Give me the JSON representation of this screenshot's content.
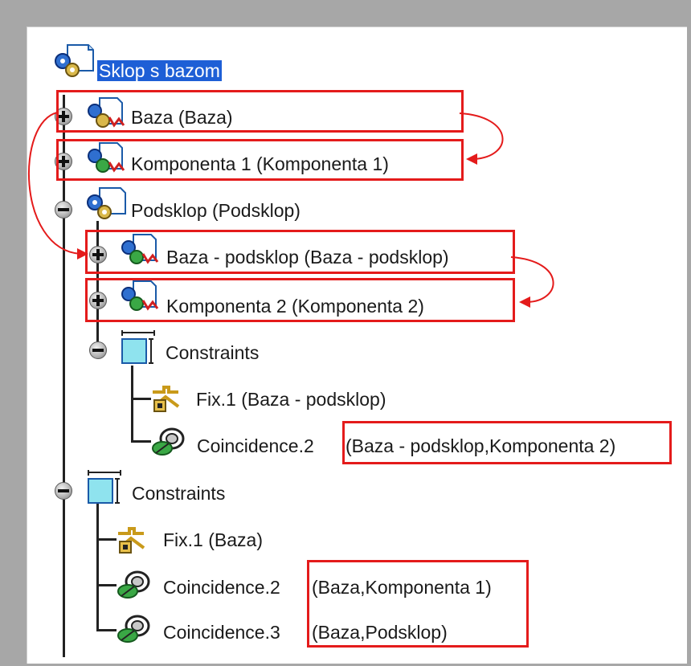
{
  "tree": {
    "root": {
      "label": "Sklop s bazom"
    },
    "baza": {
      "label": "Baza (Baza)"
    },
    "komponenta1": {
      "label": "Komponenta 1 (Komponenta 1)"
    },
    "podsklop": {
      "label": "Podsklop (Podsklop)",
      "children": {
        "baza_podsklop": {
          "label": "Baza - podsklop (Baza - podsklop)"
        },
        "komponenta2": {
          "label": "Komponenta 2 (Komponenta 2)"
        },
        "constraints": {
          "label": "Constraints",
          "fix": {
            "label": "Fix.1 (Baza - podsklop)"
          },
          "coincidence": {
            "name": "Coincidence.2",
            "parts": "(Baza - podsklop,Komponenta 2)"
          }
        }
      }
    },
    "constraints": {
      "label": "Constraints",
      "fix": {
        "label": "Fix.1 (Baza)"
      },
      "coincidence2": {
        "name": "Coincidence.2",
        "parts": "(Baza,Komponenta 1)"
      },
      "coincidence3": {
        "name": "Coincidence.3",
        "parts": "(Baza,Podsklop)"
      }
    }
  },
  "colors": {
    "highlight": "#e41b1b",
    "selection": "#1e5fd6",
    "background": "#a7a7a7"
  }
}
